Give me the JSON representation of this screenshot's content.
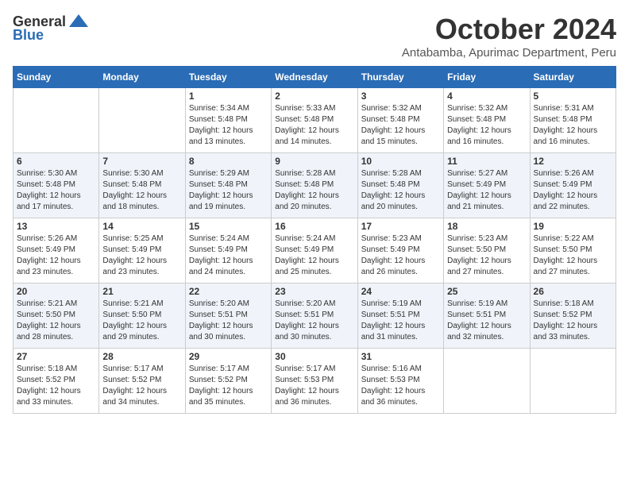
{
  "header": {
    "logo_general": "General",
    "logo_blue": "Blue",
    "month_title": "October 2024",
    "subtitle": "Antabamba, Apurimac Department, Peru"
  },
  "weekdays": [
    "Sunday",
    "Monday",
    "Tuesday",
    "Wednesday",
    "Thursday",
    "Friday",
    "Saturday"
  ],
  "weeks": [
    [
      {
        "day": "",
        "info": ""
      },
      {
        "day": "",
        "info": ""
      },
      {
        "day": "1",
        "info": "Sunrise: 5:34 AM\nSunset: 5:48 PM\nDaylight: 12 hours and 13 minutes."
      },
      {
        "day": "2",
        "info": "Sunrise: 5:33 AM\nSunset: 5:48 PM\nDaylight: 12 hours and 14 minutes."
      },
      {
        "day": "3",
        "info": "Sunrise: 5:32 AM\nSunset: 5:48 PM\nDaylight: 12 hours and 15 minutes."
      },
      {
        "day": "4",
        "info": "Sunrise: 5:32 AM\nSunset: 5:48 PM\nDaylight: 12 hours and 16 minutes."
      },
      {
        "day": "5",
        "info": "Sunrise: 5:31 AM\nSunset: 5:48 PM\nDaylight: 12 hours and 16 minutes."
      }
    ],
    [
      {
        "day": "6",
        "info": "Sunrise: 5:30 AM\nSunset: 5:48 PM\nDaylight: 12 hours and 17 minutes."
      },
      {
        "day": "7",
        "info": "Sunrise: 5:30 AM\nSunset: 5:48 PM\nDaylight: 12 hours and 18 minutes."
      },
      {
        "day": "8",
        "info": "Sunrise: 5:29 AM\nSunset: 5:48 PM\nDaylight: 12 hours and 19 minutes."
      },
      {
        "day": "9",
        "info": "Sunrise: 5:28 AM\nSunset: 5:48 PM\nDaylight: 12 hours and 20 minutes."
      },
      {
        "day": "10",
        "info": "Sunrise: 5:28 AM\nSunset: 5:48 PM\nDaylight: 12 hours and 20 minutes."
      },
      {
        "day": "11",
        "info": "Sunrise: 5:27 AM\nSunset: 5:49 PM\nDaylight: 12 hours and 21 minutes."
      },
      {
        "day": "12",
        "info": "Sunrise: 5:26 AM\nSunset: 5:49 PM\nDaylight: 12 hours and 22 minutes."
      }
    ],
    [
      {
        "day": "13",
        "info": "Sunrise: 5:26 AM\nSunset: 5:49 PM\nDaylight: 12 hours and 23 minutes."
      },
      {
        "day": "14",
        "info": "Sunrise: 5:25 AM\nSunset: 5:49 PM\nDaylight: 12 hours and 23 minutes."
      },
      {
        "day": "15",
        "info": "Sunrise: 5:24 AM\nSunset: 5:49 PM\nDaylight: 12 hours and 24 minutes."
      },
      {
        "day": "16",
        "info": "Sunrise: 5:24 AM\nSunset: 5:49 PM\nDaylight: 12 hours and 25 minutes."
      },
      {
        "day": "17",
        "info": "Sunrise: 5:23 AM\nSunset: 5:49 PM\nDaylight: 12 hours and 26 minutes."
      },
      {
        "day": "18",
        "info": "Sunrise: 5:23 AM\nSunset: 5:50 PM\nDaylight: 12 hours and 27 minutes."
      },
      {
        "day": "19",
        "info": "Sunrise: 5:22 AM\nSunset: 5:50 PM\nDaylight: 12 hours and 27 minutes."
      }
    ],
    [
      {
        "day": "20",
        "info": "Sunrise: 5:21 AM\nSunset: 5:50 PM\nDaylight: 12 hours and 28 minutes."
      },
      {
        "day": "21",
        "info": "Sunrise: 5:21 AM\nSunset: 5:50 PM\nDaylight: 12 hours and 29 minutes."
      },
      {
        "day": "22",
        "info": "Sunrise: 5:20 AM\nSunset: 5:51 PM\nDaylight: 12 hours and 30 minutes."
      },
      {
        "day": "23",
        "info": "Sunrise: 5:20 AM\nSunset: 5:51 PM\nDaylight: 12 hours and 30 minutes."
      },
      {
        "day": "24",
        "info": "Sunrise: 5:19 AM\nSunset: 5:51 PM\nDaylight: 12 hours and 31 minutes."
      },
      {
        "day": "25",
        "info": "Sunrise: 5:19 AM\nSunset: 5:51 PM\nDaylight: 12 hours and 32 minutes."
      },
      {
        "day": "26",
        "info": "Sunrise: 5:18 AM\nSunset: 5:52 PM\nDaylight: 12 hours and 33 minutes."
      }
    ],
    [
      {
        "day": "27",
        "info": "Sunrise: 5:18 AM\nSunset: 5:52 PM\nDaylight: 12 hours and 33 minutes."
      },
      {
        "day": "28",
        "info": "Sunrise: 5:17 AM\nSunset: 5:52 PM\nDaylight: 12 hours and 34 minutes."
      },
      {
        "day": "29",
        "info": "Sunrise: 5:17 AM\nSunset: 5:52 PM\nDaylight: 12 hours and 35 minutes."
      },
      {
        "day": "30",
        "info": "Sunrise: 5:17 AM\nSunset: 5:53 PM\nDaylight: 12 hours and 36 minutes."
      },
      {
        "day": "31",
        "info": "Sunrise: 5:16 AM\nSunset: 5:53 PM\nDaylight: 12 hours and 36 minutes."
      },
      {
        "day": "",
        "info": ""
      },
      {
        "day": "",
        "info": ""
      }
    ]
  ]
}
